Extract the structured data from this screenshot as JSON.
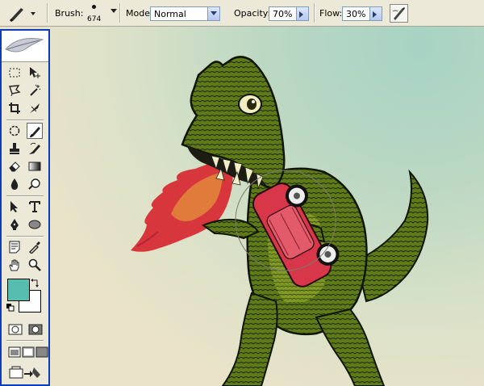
{
  "options_bar": {
    "brush_label": "Brush:",
    "brush_size": "674",
    "mode_label": "Mode:",
    "mode_value": "Normal",
    "opacity_label": "Opacity:",
    "opacity_value": "70%",
    "flow_label": "Flow:",
    "flow_value": "30%"
  },
  "toolbox": {
    "foreground_color": "#57bdb0",
    "background_color": "#ffffff",
    "tools": [
      "marquee-tool",
      "move-tool",
      "lasso-tool",
      "magic-wand-tool",
      "crop-tool",
      "slice-tool",
      "healing-brush-tool",
      "brush-tool",
      "clone-stamp-tool",
      "history-brush-tool",
      "eraser-tool",
      "gradient-tool",
      "blur-tool",
      "dodge-tool",
      "path-selection-tool",
      "type-tool",
      "pen-tool",
      "shape-tool",
      "notes-tool",
      "eyedropper-tool",
      "hand-tool",
      "zoom-tool"
    ],
    "active_tool": "brush-tool"
  },
  "canvas": {
    "illustration": "green dinosaur breathing fire holding red car"
  }
}
